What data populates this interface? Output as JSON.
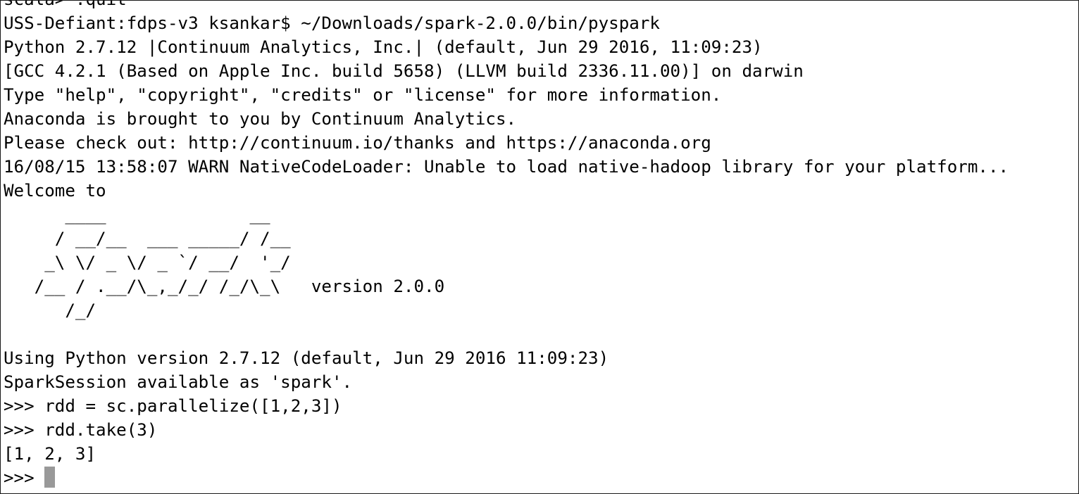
{
  "terminal": {
    "lines": [
      "scala> :quit",
      "USS-Defiant:fdps-v3 ksankar$ ~/Downloads/spark-2.0.0/bin/pyspark",
      "Python 2.7.12 |Continuum Analytics, Inc.| (default, Jun 29 2016, 11:09:23)",
      "[GCC 4.2.1 (Based on Apple Inc. build 5658) (LLVM build 2336.11.00)] on darwin",
      "Type \"help\", \"copyright\", \"credits\" or \"license\" for more information.",
      "Anaconda is brought to you by Continuum Analytics.",
      "Please check out: http://continuum.io/thanks and https://anaconda.org",
      "16/08/15 13:58:07 WARN NativeCodeLoader: Unable to load native-hadoop library for your platform...",
      "Welcome to",
      "      ____              __",
      "     / __/__  ___ _____/ /__",
      "    _\\ \\/ _ \\/ _ `/ __/  '_/",
      "   /__ / .__/\\_,_/_/ /_/\\_\\   version 2.0.0",
      "      /_/",
      "",
      "Using Python version 2.7.12 (default, Jun 29 2016 11:09:23)",
      "SparkSession available as 'spark'.",
      ">>> rdd = sc.parallelize([1,2,3])",
      ">>> rdd.take(3)",
      "[1, 2, 3]"
    ],
    "prompt": ">>> "
  }
}
